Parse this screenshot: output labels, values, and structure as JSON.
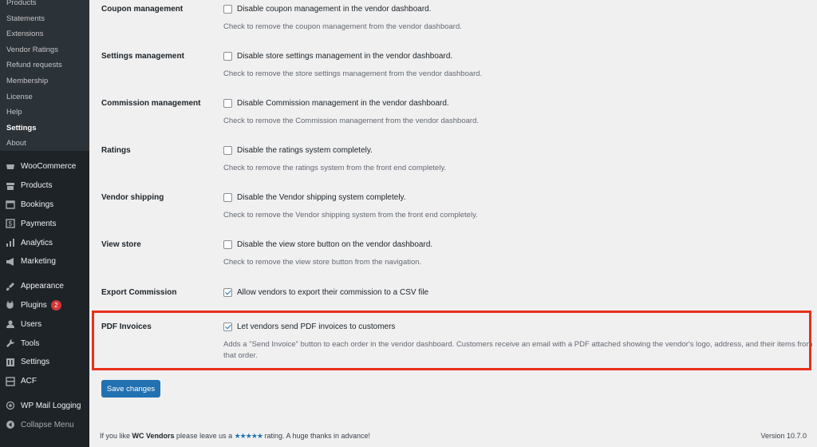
{
  "sidebar": {
    "submenu": [
      {
        "label": "Products",
        "current": false
      },
      {
        "label": "Statements",
        "current": false
      },
      {
        "label": "Extensions",
        "current": false
      },
      {
        "label": "Vendor Ratings",
        "current": false
      },
      {
        "label": "Refund requests",
        "current": false
      },
      {
        "label": "Membership",
        "current": false
      },
      {
        "label": "License",
        "current": false
      },
      {
        "label": "Help",
        "current": false
      },
      {
        "label": "Settings",
        "current": true
      },
      {
        "label": "About",
        "current": false
      }
    ],
    "menu": [
      {
        "label": "WooCommerce",
        "icon": "woocommerce-icon"
      },
      {
        "label": "Products",
        "icon": "archive-icon"
      },
      {
        "label": "Bookings",
        "icon": "calendar-icon"
      },
      {
        "label": "Payments",
        "icon": "dollar-icon"
      },
      {
        "label": "Analytics",
        "icon": "chart-bar-icon"
      },
      {
        "label": "Marketing",
        "icon": "megaphone-icon"
      },
      {
        "label": "Appearance",
        "icon": "paintbrush-icon"
      },
      {
        "label": "Plugins",
        "icon": "plug-icon",
        "badge": "2"
      },
      {
        "label": "Users",
        "icon": "user-icon"
      },
      {
        "label": "Tools",
        "icon": "wrench-icon"
      },
      {
        "label": "Settings",
        "icon": "sliders-icon"
      },
      {
        "label": "ACF",
        "icon": "grid-icon"
      },
      {
        "label": "WP Mail Logging",
        "icon": "at-sign-icon"
      },
      {
        "label": "Collapse Menu",
        "icon": "collapse-arrow-icon"
      }
    ]
  },
  "settings": [
    {
      "label": "Coupon management",
      "checkbox": "Disable coupon management in the vendor dashboard.",
      "checked": false,
      "desc": "Check to remove the coupon management from the vendor dashboard."
    },
    {
      "label": "Settings management",
      "checkbox": "Disable store settings management in the vendor dashboard.",
      "checked": false,
      "desc": "Check to remove the store settings management from the vendor dashboard."
    },
    {
      "label": "Commission management",
      "checkbox": "Disable Commission management in the vendor dashboard.",
      "checked": false,
      "desc": "Check to remove the Commission management from the vendor dashboard."
    },
    {
      "label": "Ratings",
      "checkbox": "Disable the ratings system completely.",
      "checked": false,
      "desc": "Check to remove the ratings system from the front end completely."
    },
    {
      "label": "Vendor shipping",
      "checkbox": "Disable the Vendor shipping system completely.",
      "checked": false,
      "desc": "Check to remove the Vendor shipping system from the front end completely."
    },
    {
      "label": "View store",
      "checkbox": "Disable the view store button on the vendor dashboard.",
      "checked": false,
      "desc": "Check to remove the view store button from the navigation."
    },
    {
      "label": "Export Commission",
      "checkbox": "Allow vendors to export their commission to a CSV file",
      "checked": true,
      "desc": ""
    },
    {
      "label": "PDF Invoices",
      "checkbox": "Let vendors send PDF invoices to customers",
      "checked": true,
      "desc": "Adds a \"Send Invoice\" button to each order in the vendor dashboard. Customers receive an email with a PDF attached showing the vendor's logo, address, and their items from that order."
    }
  ],
  "save_label": "Save changes",
  "footer": {
    "prefix": "If you like ",
    "brand": "WC Vendors",
    "middle": " please leave us a ",
    "stars": "★★★★★",
    "suffix": " rating. A huge thanks in advance!",
    "version": "Version 10.7.0"
  },
  "colors": {
    "highlight": "#e8301a",
    "accent": "#2271b1",
    "sidebar": "#1d2327"
  }
}
